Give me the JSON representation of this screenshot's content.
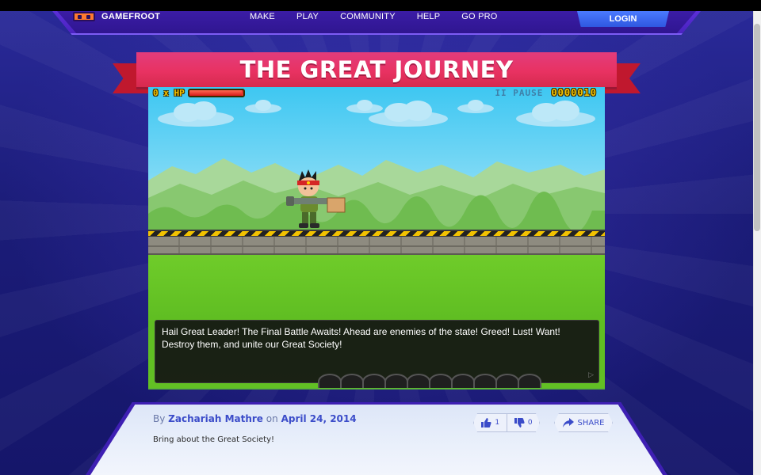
{
  "nav": {
    "logo_text": "GAMEFROOT",
    "links": [
      "MAKE",
      "PLAY",
      "COMMUNITY",
      "HELP",
      "GO PRO"
    ],
    "login_label": "LOGIN"
  },
  "game": {
    "title": "THE GREAT JOURNEY",
    "hud": {
      "lives_label": "0 x HP",
      "hp_fraction": 0.98,
      "pause_label": "II PAUSE",
      "score": "0000010"
    },
    "dialog_text": "Hail Great Leader! The Final Battle Awaits! Ahead are enemies of the state! Greed! Lust! Want! Destroy them, and unite our Great Society!",
    "dialog_continue": "▷"
  },
  "meta": {
    "by_prefix": "By",
    "author": "Zachariah Mathre",
    "on_word": "on",
    "date": "April 24, 2014",
    "description": "Bring about the Great Society!",
    "likes": "1",
    "dislikes": "0",
    "share_label": "SHARE"
  },
  "icons": {
    "like": "thumbs-up-icon",
    "dislike": "thumbs-down-icon",
    "share": "share-arrow-icon"
  },
  "colors": {
    "accent": "#3b4cc9",
    "ribbon": "#e83262",
    "nav": "#3b1ca6"
  }
}
